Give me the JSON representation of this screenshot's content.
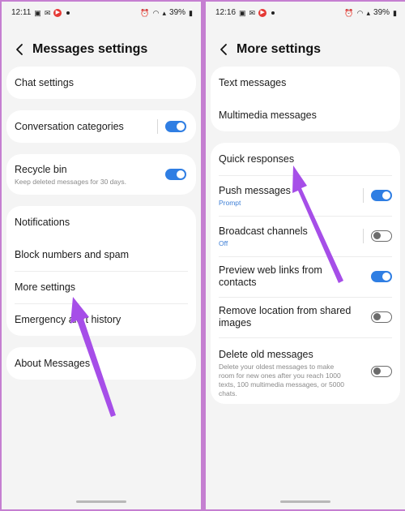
{
  "left": {
    "status": {
      "time": "12:11",
      "battery": "39%"
    },
    "header": {
      "title": "Messages settings"
    },
    "cards": {
      "chat_settings": "Chat settings",
      "conversation_categories": "Conversation categories",
      "recycle_bin": {
        "title": "Recycle bin",
        "subtitle": "Keep deleted messages for 30 days."
      },
      "menu": [
        "Notifications",
        "Block numbers and spam",
        "More settings",
        "Emergency alert history"
      ],
      "about": "About Messages"
    }
  },
  "right": {
    "status": {
      "time": "12:16",
      "battery": "39%"
    },
    "header": {
      "title": "More settings"
    },
    "cards": {
      "text_messages": "Text messages",
      "multimedia_messages": "Multimedia messages",
      "quick_responses": "Quick responses",
      "push_messages": {
        "title": "Push messages",
        "subtitle": "Prompt",
        "enabled": true
      },
      "broadcast_channels": {
        "title": "Broadcast channels",
        "subtitle": "Off",
        "enabled": false
      },
      "preview_web_links": {
        "title_line1": "Preview web links from",
        "title_line2": "contacts",
        "enabled": true
      },
      "remove_location": {
        "title_line1": "Remove location from shared",
        "title_line2": "images",
        "enabled": false
      },
      "delete_old_messages": {
        "title": "Delete old messages",
        "subtitle_lines": [
          "Delete your oldest messages to make",
          "room for new ones after you reach 1000",
          "texts, 100 multimedia messages, or 5000",
          "chats."
        ],
        "enabled": false
      }
    }
  },
  "colors": {
    "accent": "#2f7ee3",
    "arrow": "#a64ee8",
    "frame": "#c57fd1"
  }
}
